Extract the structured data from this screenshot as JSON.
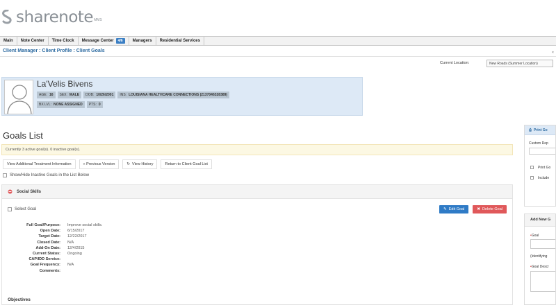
{
  "app": {
    "brand": "sharenote",
    "brand_sup": "MMS",
    "colors": {
      "accent": "#2c6aa0",
      "card_bg": "#dde9f6",
      "info_bg": "#fcf8e3",
      "edit": "#2f7bc6",
      "delete": "#e0585a",
      "badge": "#3b7fc4"
    }
  },
  "nav": {
    "items": [
      "Main",
      "Note Center",
      "Time Clock",
      "Message Center",
      "Managers",
      "Residential Services"
    ],
    "message_badge": "4/6"
  },
  "breadcrumb": "Client Manager : Client Profile : Client Goals",
  "location": {
    "label": "Current Location:",
    "value": "New Roads (Summer Location)"
  },
  "client": {
    "name": "La'Velis Bivens",
    "tags_row1": [
      {
        "label": "AGE:",
        "value": "16"
      },
      {
        "label": "SEX:",
        "value": "MALE"
      },
      {
        "label": "DOB:",
        "value": "10/26/2001"
      },
      {
        "label": "INS:",
        "value": "LOUISIANA HEALTHCARE CONNECTIONS (2137046328389)"
      }
    ],
    "tags_row2": [
      {
        "label": "BX LVL:",
        "value": "NONE ASSIGNED"
      },
      {
        "label": "PTS:",
        "value": "0"
      }
    ]
  },
  "goals": {
    "title": "Goals List",
    "info": "Currently 3 active goal(s). 0 inactive goal(s).",
    "buttons": [
      "View Additional Treatment Information",
      "« Previous Version",
      "View History",
      "Return to Client Goal List"
    ],
    "show_hide_label": "Show/Hide Inactive Goals in the List Below"
  },
  "panel": {
    "title": "Social Skills",
    "select_goal": "Select Goal",
    "edit_label": "Edit Goal",
    "delete_label": "Delete Goal",
    "details": [
      {
        "label": "Full Goal/Purpose:",
        "value": "Improve social skills."
      },
      {
        "label": "Open Date:",
        "value": "6/15/2017"
      },
      {
        "label": "Target Date:",
        "value": "12/22/2017"
      },
      {
        "label": "Closed Date:",
        "value": "N/A"
      },
      {
        "label": "Add-On Date:",
        "value": "12/4/2015"
      },
      {
        "label": "Current Status:",
        "value": "Ongoing"
      },
      {
        "label": "CAP/IDD Service:",
        "value": ""
      },
      {
        "label": "Goal Frequency:",
        "value": "N/A"
      },
      {
        "label": "Comments:",
        "value": ""
      }
    ],
    "objectives": "Objectives"
  },
  "sidebar": {
    "print_title": "Print Go",
    "custom_rep": "Custom Rep",
    "print_goal": "Print Go",
    "include": "Include",
    "add_new": "Add New G",
    "goal_label": "Goal",
    "identifying": "(Identifying",
    "goal_desc": "Goal Descr"
  }
}
